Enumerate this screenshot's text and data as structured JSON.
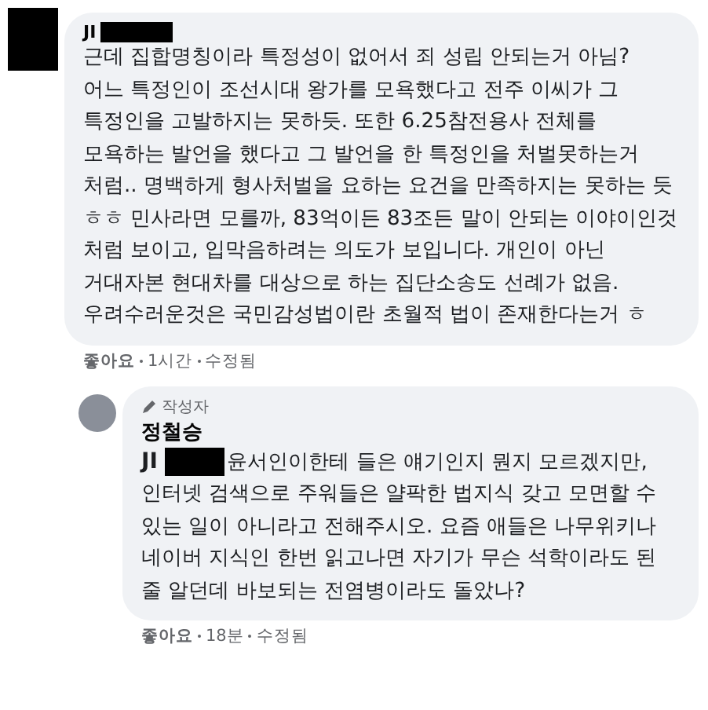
{
  "comments": [
    {
      "kind": "comment",
      "author": "JI",
      "author_redacted": true,
      "body": "근데 집합명칭이라 특정성이 없어서 죄 성립 안되는거 아님?\n어느 특정인이 조선시대 왕가를 모욕했다고 전주 이씨가 그 특정인을 고발하지는 못하듯. 또한 6.25참전용사 전체를 모욕하는 발언을 했다고 그 발언을 한 특정인을 처벌못하는거 처럼.. 명백하게 형사처벌을 요하는 요건을 만족하지는 못하는 듯 ㅎㅎ 민사라면 모를까, 83억이든 83조든 말이 안되는 이야이인것 처럼 보이고, 입막음하려는 의도가 보입니다. 개인이 아닌 거대자본 현대차를 대상으로 하는 집단소송도 선례가 없음. 우려수러운것은 국민감성법이란 초월적 법이 존재한다는거 ㅎ",
      "actions": [
        "좋아요",
        "1시간",
        "수정됨"
      ]
    },
    {
      "kind": "reply",
      "badge": "작성자",
      "author": "정철승",
      "mention": "JI",
      "mention_redacted": true,
      "body": "윤서인이한테 들은 얘기인지 뭔지 모르겠지만, 인터넷 검색으로 주워들은 얄팍한 법지식 갖고 모면할 수 있는 일이 아니라고 전해주시오. 요즘 애들은 나무위키나 네이버 지식인 한번 읽고나면 자기가 무슨 석학이라도 된 줄 알던데 바보되는 전염병이라도 돌았나?",
      "actions": [
        "좋아요",
        "18분",
        "수정됨"
      ]
    }
  ]
}
